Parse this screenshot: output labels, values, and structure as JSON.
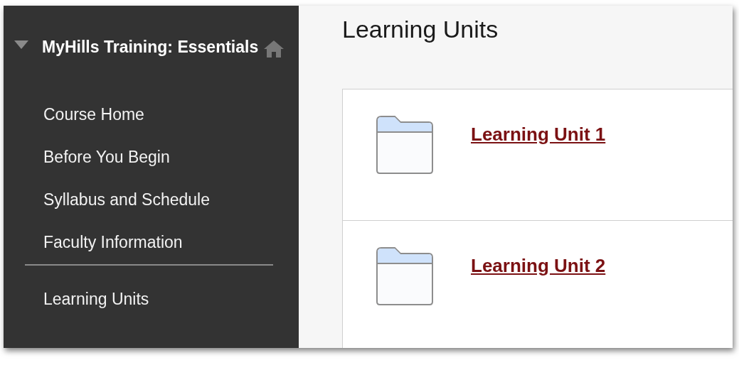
{
  "sidebar": {
    "course_title": "MyHills Training: Essentials",
    "expanded": true,
    "menu_groups": [
      {
        "items": [
          {
            "label": "Course Home"
          },
          {
            "label": "Before You Begin"
          },
          {
            "label": "Syllabus and Schedule"
          },
          {
            "label": "Faculty Information"
          }
        ]
      },
      {
        "items": [
          {
            "label": "Learning Units"
          }
        ]
      }
    ]
  },
  "content": {
    "title": "Learning Units",
    "items": [
      {
        "kind": "folder",
        "label": "Learning Unit 1"
      },
      {
        "kind": "folder",
        "label": "Learning Unit 2"
      }
    ]
  }
}
